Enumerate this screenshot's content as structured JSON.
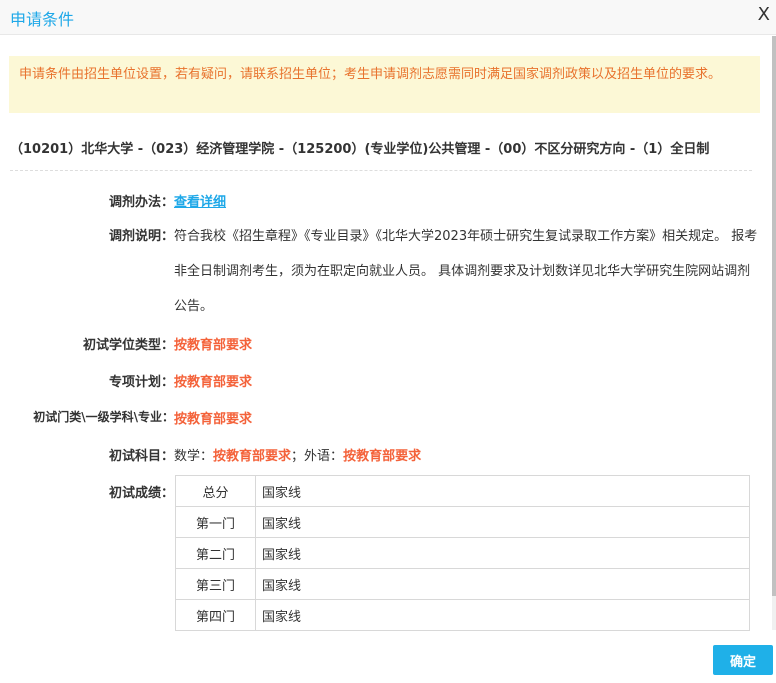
{
  "dialog": {
    "title": "申请条件",
    "close": "X",
    "confirm": "确定"
  },
  "notice": "申请条件由招生单位设置，若有疑问，请联系招生单位；考生申请调剂志愿需同时满足国家调剂政策以及招生单位的要求。",
  "path": "（10201）北华大学 -（023）经济管理学院 -（125200）(专业学位)公共管理 -（00）不区分研究方向 -（1）全日制",
  "fields": {
    "method_label": "调剂办法：",
    "method_link": "查看详细",
    "desc_label": "调剂说明：",
    "desc": "符合我校《招生章程》《专业目录》《北华大学2023年硕士研究生复试录取工作方案》相关规定。 报考非全日制调剂考生，须为在职定向就业人员。 具体调剂要求及计划数详见北华大学研究生院网站调剂公告。",
    "degree_label": "初试学位类型：",
    "degree": "按教育部要求",
    "special_label": "专项计划：",
    "special": "按教育部要求",
    "major_label": "初试门类\\一级学科\\专业：",
    "major": "按教育部要求",
    "subjects_label": "初试科目：",
    "math_label": "数学：",
    "math": "按教育部要求",
    "sep": "；",
    "lang_label": "外语：",
    "lang": "按教育部要求",
    "score_label": "初试成绩："
  },
  "scores": [
    [
      "总分",
      "国家线"
    ],
    [
      "第一门",
      "国家线"
    ],
    [
      "第二门",
      "国家线"
    ],
    [
      "第三门",
      "国家线"
    ],
    [
      "第四门",
      "国家线"
    ]
  ]
}
